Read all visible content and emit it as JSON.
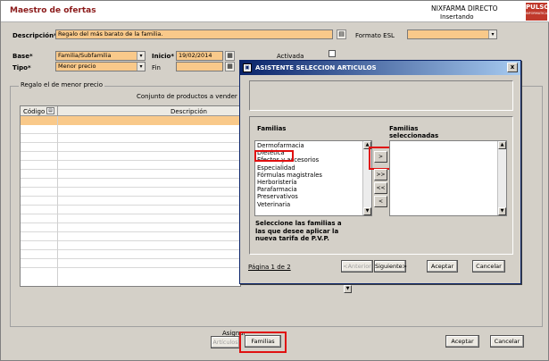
{
  "header": {
    "title": "Maestro de ofertas",
    "brand": "NIXFARMA DIRECTO",
    "status": "Insertando",
    "logo": "PULSO",
    "logo_sub": "INFORMATICA"
  },
  "form": {
    "descripcion_label": "Descripción*",
    "descripcion_value": "Regalo del más barato de la familia.",
    "formato_label": "Formato ESL",
    "formato_value": "",
    "base_label": "Base*",
    "base_value": "Familia/Subfamilia",
    "inicio_label": "Inicio*",
    "inicio_value": "19/02/2014",
    "activada_label": "Activada",
    "tipo_label": "Tipo*",
    "tipo_value": "Menor precio",
    "fin_label": "Fin",
    "fin_value": ""
  },
  "group": {
    "label": "Regalo el de menor precio",
    "subtitle": "Conjunto de productos a vender",
    "col_codigo": "Código",
    "col_descripcion": "Descripción"
  },
  "footer": {
    "asignar_label": "Asignar",
    "articulos_button": "Artículos",
    "familias_button": "Familias",
    "aceptar_button": "Aceptar",
    "cancelar_button": "Cancelar"
  },
  "dialog": {
    "title": "ASISTENTE SELECCION ARTICULOS",
    "close": "x",
    "familias_label": "Familias",
    "seleccionadas_label": "Familias seleccionadas",
    "familias": [
      "Dermofarmacia",
      "Dietética",
      "Efectos y accesorios",
      "Especialidad",
      "Fórmulas magistrales",
      "Herboristería",
      "Parafarmacia",
      "Preservativos",
      "Veterinaria"
    ],
    "selected_familia": "Dietética",
    "move_buttons": [
      ">",
      ">>",
      "<<",
      "<"
    ],
    "instruction": "Seleccione las familias a las que desee aplicar la nueva tarifa de P.V.P.",
    "page_label": "Página 1 de 2",
    "anterior_button": "<Anterior",
    "siguiente_button": "Siguiente>",
    "aceptar_button": "Aceptar",
    "cancelar_button": "Cancelar"
  },
  "colors": {
    "highlight": "#e01010",
    "mandatory_field": "#f9c98a",
    "dialog_title": "#0a246a"
  }
}
